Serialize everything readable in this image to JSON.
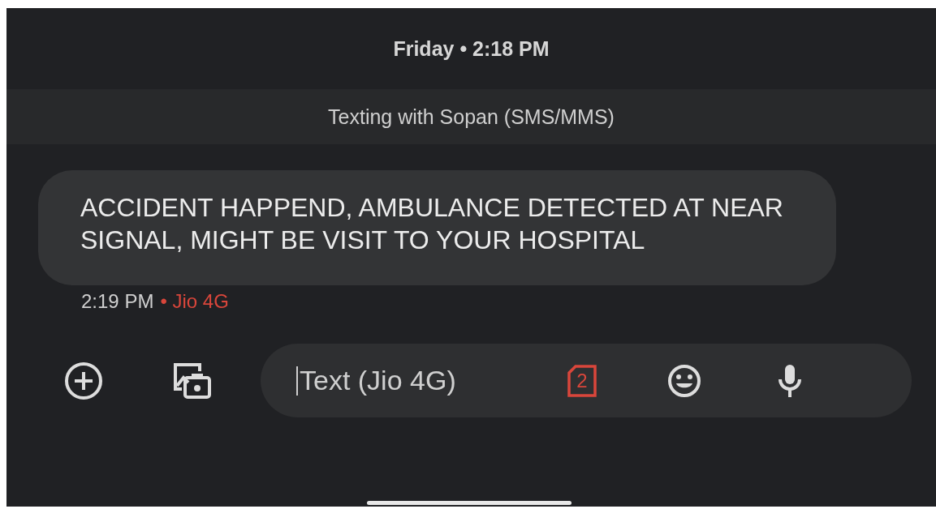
{
  "header": {
    "date_line": "Friday • 2:18 PM",
    "banner": "Texting with Sopan (SMS/MMS)"
  },
  "messages": [
    {
      "text": "ACCIDENT HAPPEND, AMBULANCE DETECTED AT NEAR SIGNAL, MIGHT BE VISIT TO YOUR HOSPITAL",
      "time": "2:19 PM",
      "network": "• Jio 4G"
    }
  ],
  "composer": {
    "placeholder": "Text (Jio 4G)",
    "sim_badge": "2"
  }
}
